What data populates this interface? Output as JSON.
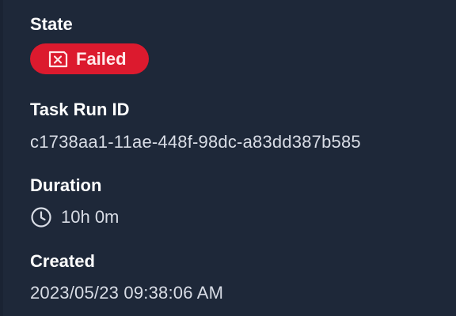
{
  "state": {
    "label": "State",
    "badge": {
      "icon": "x-square-icon",
      "text": "Failed",
      "color": "#dc1a2e"
    }
  },
  "task_run_id": {
    "label": "Task Run ID",
    "value": "c1738aa1-11ae-448f-98dc-a83dd387b585"
  },
  "duration": {
    "label": "Duration",
    "icon": "clock-icon",
    "value": "10h 0m"
  },
  "created": {
    "label": "Created",
    "value": "2023/05/23 09:38:06 AM"
  }
}
